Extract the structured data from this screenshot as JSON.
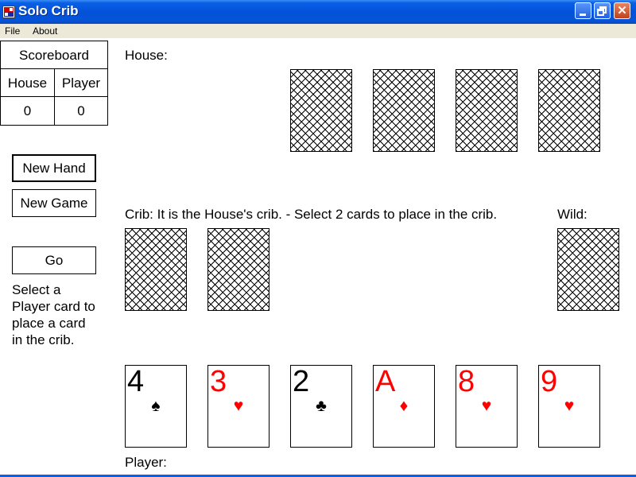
{
  "window": {
    "title": "Solo Crib"
  },
  "menu": {
    "file": "File",
    "about": "About"
  },
  "scoreboard": {
    "title": "Scoreboard",
    "house_header": "House",
    "player_header": "Player",
    "house_score": "0",
    "player_score": "0"
  },
  "buttons": {
    "new_hand": "New Hand",
    "new_game": "New Game",
    "go": "Go"
  },
  "instructions": "Select a Player card to place a card in the crib.",
  "labels": {
    "house": "House:",
    "crib": "Crib:  It is the House's crib. - Select 2 cards to place in the crib.",
    "wild": "Wild:",
    "player": "Player:"
  },
  "player_hand": [
    {
      "rank": "4",
      "suit": "♠",
      "color": "#000000"
    },
    {
      "rank": "3",
      "suit": "♥",
      "color": "#ff0000"
    },
    {
      "rank": "2",
      "suit": "♣",
      "color": "#000000"
    },
    {
      "rank": "A",
      "suit": "♦",
      "color": "#ff0000"
    },
    {
      "rank": "8",
      "suit": "♥",
      "color": "#ff0000"
    },
    {
      "rank": "9",
      "suit": "♥",
      "color": "#ff0000"
    }
  ],
  "card_back_pattern": "crosshatch-icon"
}
